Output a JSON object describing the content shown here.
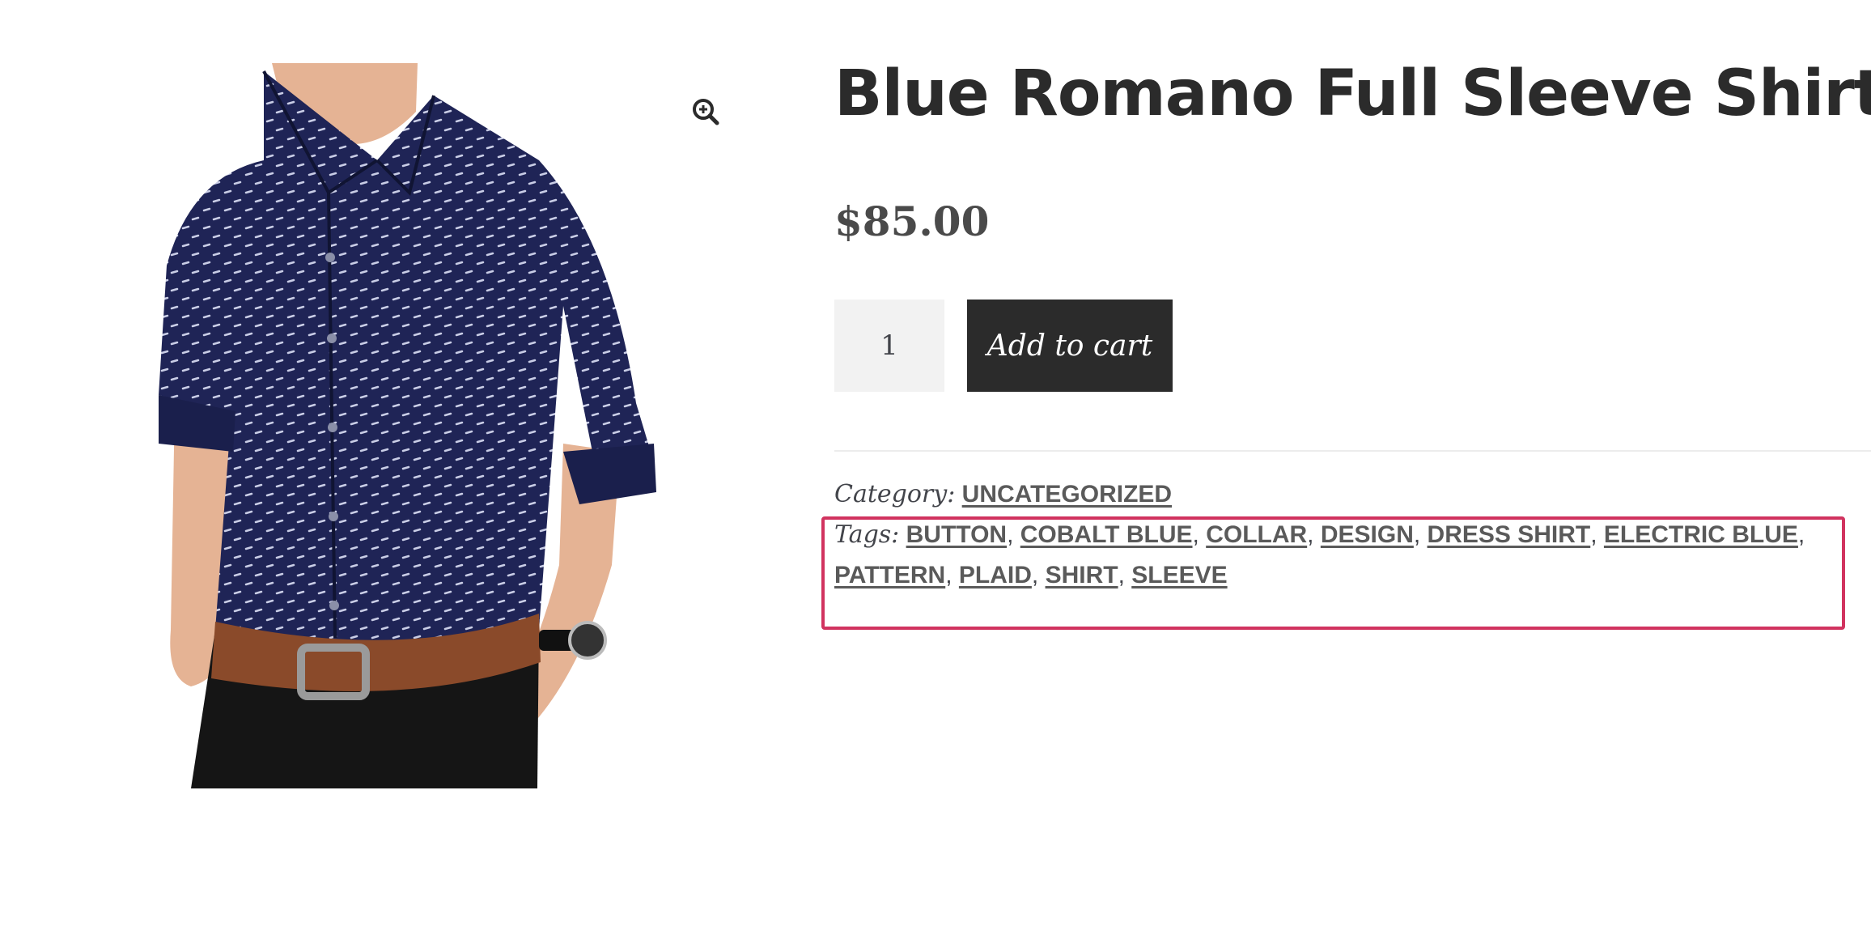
{
  "product": {
    "title": "Blue Romano Full Sleeve Shirt",
    "price": "$85.00",
    "image_icon": "shirt-model-photo",
    "colors": {
      "shirt": "#1f2456",
      "dots": "#c9cde6",
      "belt": "#8a4a2a",
      "pants": "#151515",
      "skin": "#e5b394"
    }
  },
  "gallery": {
    "zoom_icon": "magnify-plus-icon"
  },
  "cart": {
    "quantity": "1",
    "add_label": "Add to cart",
    "button_color": "#2b2b2b"
  },
  "meta": {
    "category_label": "Category:",
    "category": "UNCATEGORIZED",
    "tags_label": "Tags:",
    "tags": [
      "BUTTON",
      "COBALT BLUE",
      "COLLAR",
      "DESIGN",
      "DRESS SHIRT",
      "ELECTRIC BLUE",
      "PATTERN",
      "PLAID",
      "SHIRT",
      "SLEEVE"
    ],
    "highlight_color": "#d1335f"
  }
}
